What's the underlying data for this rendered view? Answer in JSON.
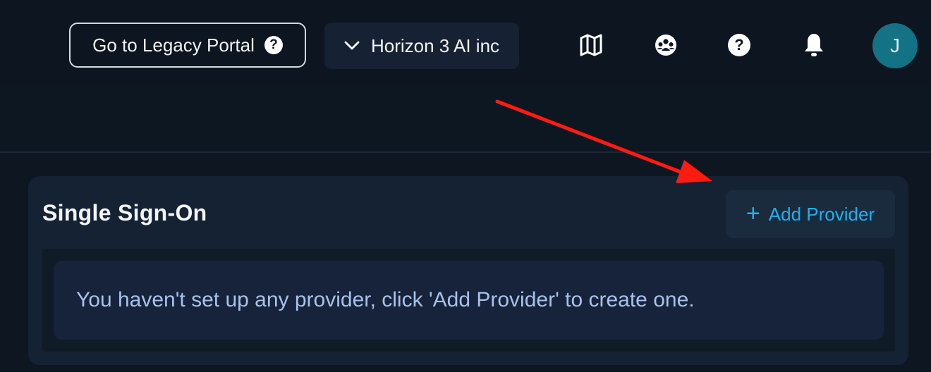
{
  "header": {
    "legacy_label": "Go to Legacy Portal",
    "legacy_help_glyph": "?",
    "org_label": "Horizon 3 AI inc",
    "icons": [
      "map-icon",
      "community-icon",
      "help-icon",
      "bell-icon"
    ],
    "help_glyph": "?",
    "avatar_initial": "J"
  },
  "sso": {
    "title": "Single Sign-On",
    "add_plus": "+",
    "add_label": "Add Provider",
    "empty_message": "You haven't set up any provider, click 'Add Provider' to create one."
  },
  "colors": {
    "background": "#0e1622",
    "card": "#152233",
    "accent": "#1fb0ec",
    "avatar": "#137284",
    "annotation_arrow": "#ff1a12"
  }
}
